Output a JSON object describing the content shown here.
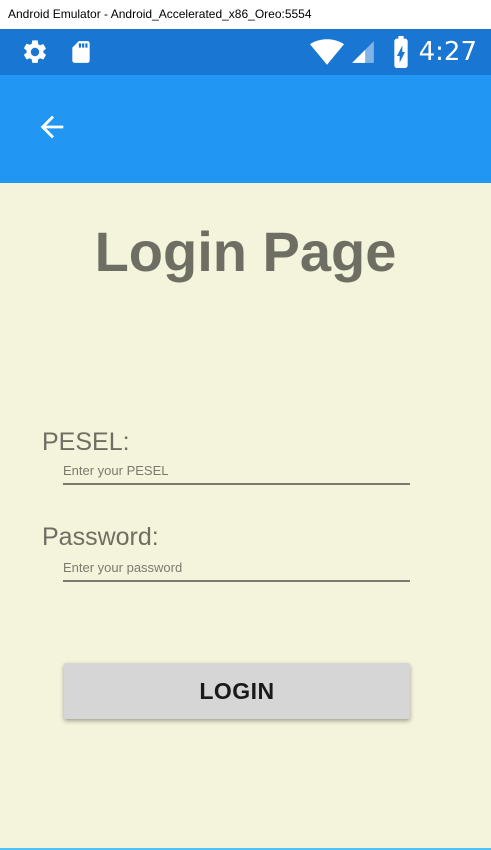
{
  "window": {
    "title": "Android Emulator - Android_Accelerated_x86_Oreo:5554"
  },
  "status_bar": {
    "time": "4:27",
    "icons": [
      "settings-icon",
      "sd-card-icon",
      "wifi-icon",
      "cellular-signal-icon",
      "battery-charging-icon"
    ],
    "color": "#1976D2"
  },
  "app_bar": {
    "back_icon": "arrow-back-icon",
    "color": "#2196F3"
  },
  "login_page": {
    "title": "Login Page",
    "pesel": {
      "label": "PESEL:",
      "value": "",
      "placeholder": "Enter your PESEL"
    },
    "password": {
      "label": "Password:",
      "value": "",
      "placeholder": "Enter your password"
    },
    "login_button_label": "LOGIN",
    "background_color": "#F4F4DC"
  }
}
